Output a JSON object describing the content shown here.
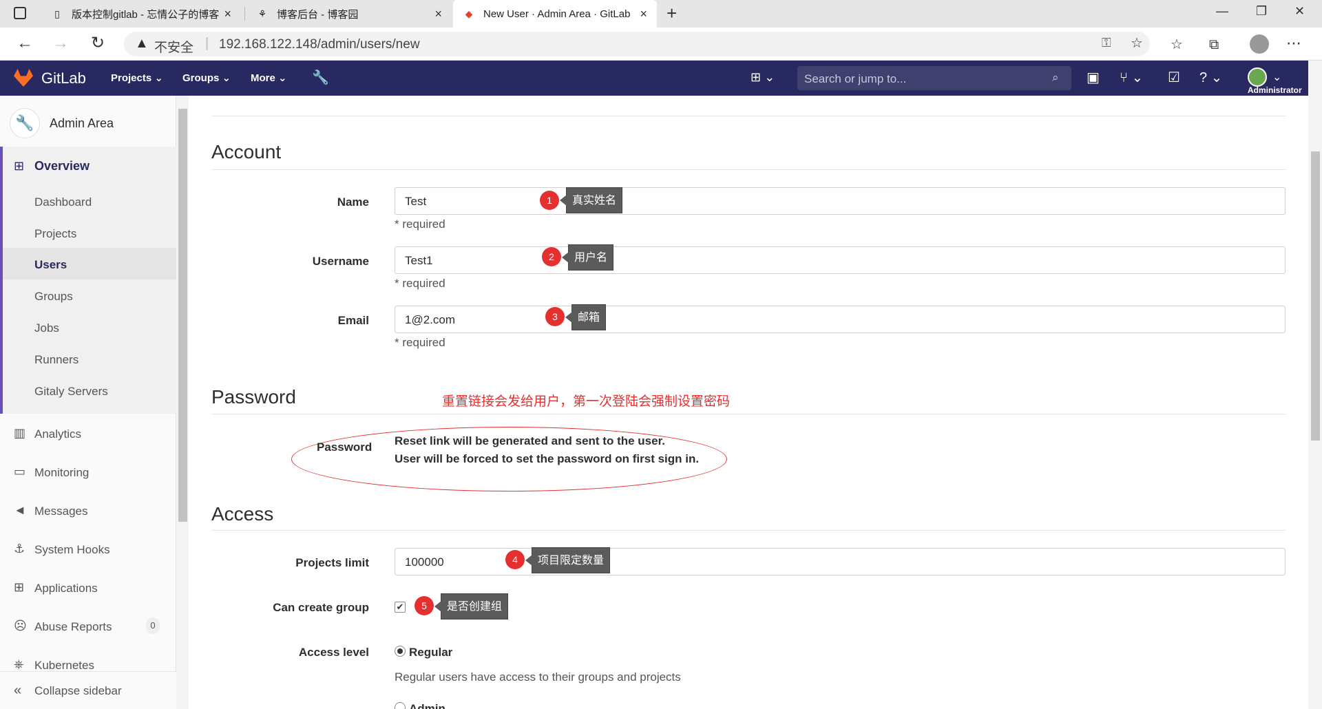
{
  "browser": {
    "tabs": [
      {
        "title": "版本控制gitlab - 忘情公子的博客"
      },
      {
        "title": "博客后台 - 博客园"
      },
      {
        "title": "New User · Admin Area · GitLab"
      }
    ],
    "security_label": "不安全",
    "url": "192.168.122.148/admin/users/new"
  },
  "header": {
    "brand": "GitLab",
    "nav": [
      "Projects",
      "Groups",
      "More"
    ],
    "search_placeholder": "Search or jump to...",
    "user": "Administrator",
    "colors": {
      "header_bg": "#292961",
      "accent": "#6b4fbb"
    }
  },
  "sidebar": {
    "title": "Admin Area",
    "overview": "Overview",
    "sub": [
      "Dashboard",
      "Projects",
      "Users",
      "Groups",
      "Jobs",
      "Runners",
      "Gitaly Servers"
    ],
    "active_sub": "Users",
    "items": [
      "Analytics",
      "Monitoring",
      "Messages",
      "System Hooks",
      "Applications",
      "Abuse Reports",
      "Kubernetes"
    ],
    "abuse_count": "0",
    "collapse": "Collapse sidebar"
  },
  "form": {
    "account_heading": "Account",
    "name_label": "Name",
    "name_value": "Test",
    "username_label": "Username",
    "username_value": "Test1",
    "email_label": "Email",
    "email_value": "1@2.com",
    "required": "* required",
    "password_heading": "Password",
    "password_label": "Password",
    "password_line1": "Reset link will be generated and sent to the user.",
    "password_line2": "User will be forced to set the password on first sign in.",
    "access_heading": "Access",
    "projects_limit_label": "Projects limit",
    "projects_limit_value": "100000",
    "can_create_group_label": "Can create group",
    "can_create_group_checked": true,
    "access_level_label": "Access level",
    "regular_label": "Regular",
    "regular_desc": "Regular users have access to their groups and projects",
    "admin_label": "Admin"
  },
  "annotations": {
    "n1": "1",
    "t1": "真实姓名",
    "n2": "2",
    "t2": "用户名",
    "n3": "3",
    "t3": "邮箱",
    "n4": "4",
    "t4": "项目限定数量",
    "n5": "5",
    "t5": "是否创建组",
    "note": "重置链接会发给用户，第一次登陆会强制设置密码",
    "color": "#e53030"
  }
}
